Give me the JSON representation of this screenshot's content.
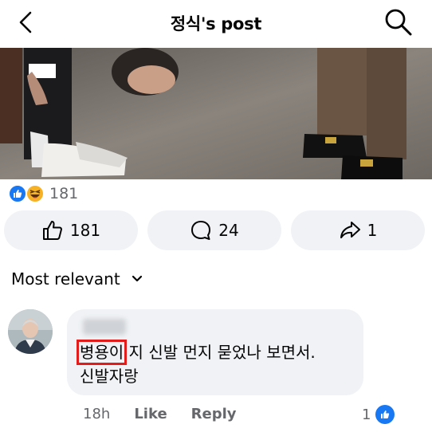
{
  "header": {
    "title": "정식's post",
    "back_icon": "chevron-left-icon",
    "search_icon": "search-icon"
  },
  "post": {
    "reactions": {
      "icons": [
        "like",
        "haha"
      ],
      "count": "181"
    },
    "actions": [
      {
        "name": "like",
        "icon": "thumbs-up-icon",
        "count": "181"
      },
      {
        "name": "comment",
        "icon": "comment-icon",
        "count": "24"
      },
      {
        "name": "share",
        "icon": "share-icon",
        "count": "1"
      }
    ]
  },
  "comments_section": {
    "sort_label": "Most relevant"
  },
  "comment": {
    "highlighted_word": "병용이",
    "text_line1_rest": " 지 신발 먼지 묻었나 보면서.",
    "text_line2": "신발자랑",
    "time": "18h",
    "like_label": "Like",
    "reply_label": "Reply",
    "reaction_count": "1"
  },
  "colors": {
    "accent": "#1877f2",
    "button_bg": "#f0f2f5",
    "secondary_text": "#65676b",
    "highlight_box": "#e21b1b",
    "haha_yellow": "#f7b125"
  }
}
